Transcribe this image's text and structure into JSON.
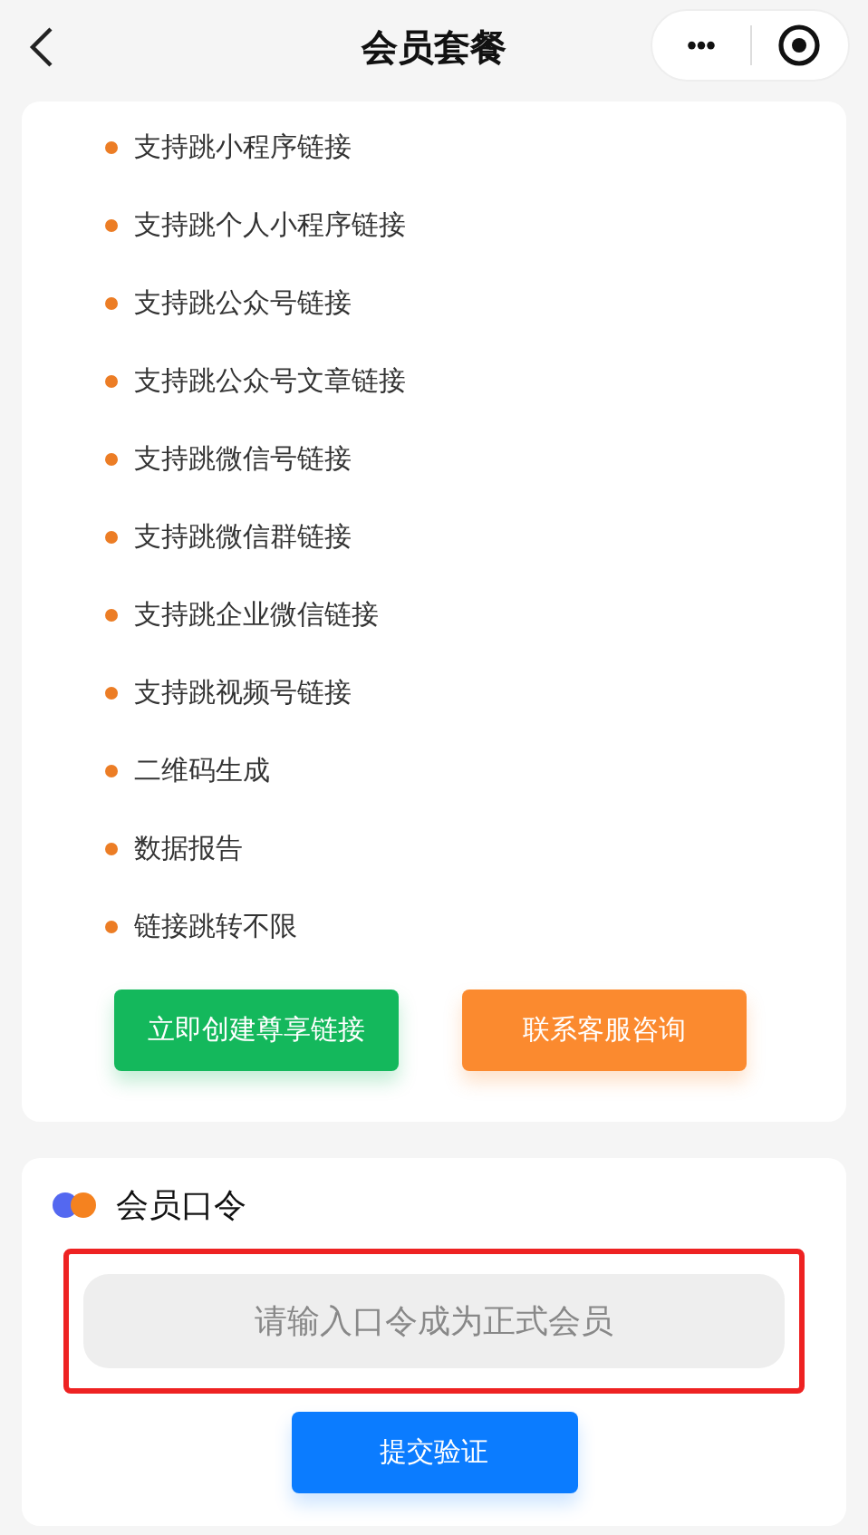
{
  "nav": {
    "title": "会员套餐",
    "more": "•••"
  },
  "features": [
    "支持跳小程序链接",
    "支持跳个人小程序链接",
    "支持跳公众号链接",
    "支持跳公众号文章链接",
    "支持跳微信号链接",
    "支持跳微信群链接",
    "支持跳企业微信链接",
    "支持跳视频号链接",
    "二维码生成",
    "数据报告",
    "链接跳转不限"
  ],
  "actions": [
    {
      "label": "立即创建尊享链接",
      "kind": "primary"
    },
    {
      "label": "联系客服咨询",
      "kind": "secondary"
    }
  ],
  "code_section": {
    "title": "会员口令",
    "placeholder": "请输入口令成为正式会员",
    "highlighted": true,
    "submit": "提交验证"
  }
}
